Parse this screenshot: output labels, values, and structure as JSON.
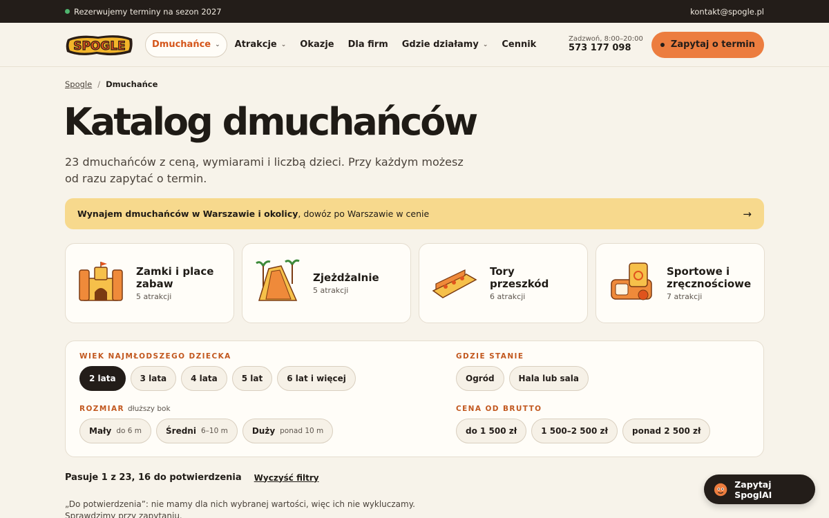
{
  "topbar": {
    "status": "Rezerwujemy terminy na sezon 2027",
    "email": "kontakt@spogle.pl"
  },
  "nav": {
    "logo_text": "SPOGLE",
    "items": [
      {
        "label": "Dmuchańce",
        "dropdown": true,
        "active": true
      },
      {
        "label": "Atrakcje",
        "dropdown": true
      },
      {
        "label": "Okazje",
        "dropdown": false
      },
      {
        "label": "Dla firm",
        "dropdown": false
      },
      {
        "label": "Gdzie działamy",
        "dropdown": true
      },
      {
        "label": "Cennik",
        "dropdown": false
      }
    ],
    "phone_hours": "Zadzwoń, 8:00–20:00",
    "phone": "573 177 098",
    "cta": "Zapytaj o termin"
  },
  "breadcrumb": {
    "home": "Spogle",
    "separator": "/",
    "current": "Dmuchańce"
  },
  "page": {
    "title": "Katalog dmuchańców",
    "lead": "23 dmuchańców z ceną, wymiarami i liczbą dzieci. Przy każdym możesz od razu zapytać o termin."
  },
  "banner": {
    "bold": "Wynajem dmuchańców w Warszawie i okolicy",
    "rest": ", dowóz po Warszawie w cenie"
  },
  "categories": [
    {
      "title": "Zamki i place zabaw",
      "count": "5 atrakcji",
      "icon": "castle-icon"
    },
    {
      "title": "Zjeżdżalnie",
      "count": "5 atrakcji",
      "icon": "slide-icon"
    },
    {
      "title": "Tory przeszkód",
      "count": "6 atrakcji",
      "icon": "obstacle-course-icon"
    },
    {
      "title": "Sportowe i zręcznościowe",
      "count": "7 atrakcji",
      "icon": "sport-icon"
    }
  ],
  "filters": {
    "age": {
      "label": "WIEK NAJMŁODSZEGO DZIECKA",
      "options": [
        "2 lata",
        "3 lata",
        "4 lata",
        "5 lat",
        "6 lat i więcej"
      ],
      "selected": "2 lata"
    },
    "size": {
      "label": "ROZMIAR",
      "sublabel": "dłuższy bok",
      "options": [
        {
          "label": "Mały",
          "sub": "do 6 m"
        },
        {
          "label": "Średni",
          "sub": "6–10 m"
        },
        {
          "label": "Duży",
          "sub": "ponad 10 m"
        }
      ]
    },
    "place": {
      "label": "GDZIE STANIE",
      "options": [
        "Ogród",
        "Hala lub sala"
      ]
    },
    "price": {
      "label": "CENA OD BRUTTO",
      "options": [
        "do 1 500 zł",
        "1 500–2 500 zł",
        "ponad 2 500 zł"
      ]
    }
  },
  "results": {
    "count": "Pasuje 1 z 23, 16 do potwierdzenia",
    "clear": "Wyczyść filtry"
  },
  "note": "„Do potwierdzenia”: nie mamy dla nich wybranej wartości, więc ich nie wykluczamy. Sprawdzimy przy zapytaniu.",
  "chat": {
    "label": "Zapytaj SpoglAI"
  },
  "colors": {
    "accent": "#ec7d3f",
    "dark": "#231d19",
    "banner": "#f7d98d",
    "background": "#f7f3ea"
  }
}
